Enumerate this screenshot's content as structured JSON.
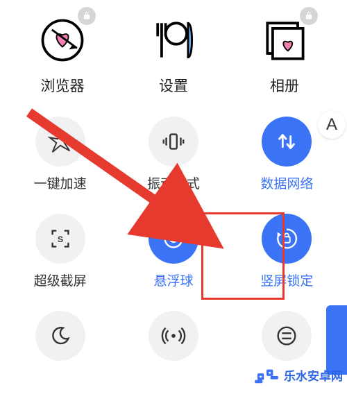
{
  "apps": [
    {
      "id": "browser",
      "label": "浏览器",
      "locked": true
    },
    {
      "id": "settings",
      "label": "设置",
      "locked": false
    },
    {
      "id": "gallery",
      "label": "相册",
      "locked": true
    }
  ],
  "toggles": [
    {
      "id": "boost",
      "label": "一键加速",
      "active": false
    },
    {
      "id": "vibrate",
      "label": "振动模式",
      "active": false
    },
    {
      "id": "data",
      "label": "数据网络",
      "active": true
    },
    {
      "id": "sshot",
      "label": "超级截屏",
      "active": false
    },
    {
      "id": "floatball",
      "label": "悬浮球",
      "active": true
    },
    {
      "id": "orient",
      "label": "竖屏锁定",
      "active": true
    },
    {
      "id": "dnd",
      "label": "",
      "active": false
    },
    {
      "id": "hotspot",
      "label": "",
      "active": false
    },
    {
      "id": "more",
      "label": "",
      "active": false
    }
  ],
  "right": {
    "a_label": "A"
  },
  "watermark": {
    "text": "乐水安卓网"
  },
  "colors": {
    "accent": "#3a73f6",
    "highlight": "#e63a2e"
  }
}
